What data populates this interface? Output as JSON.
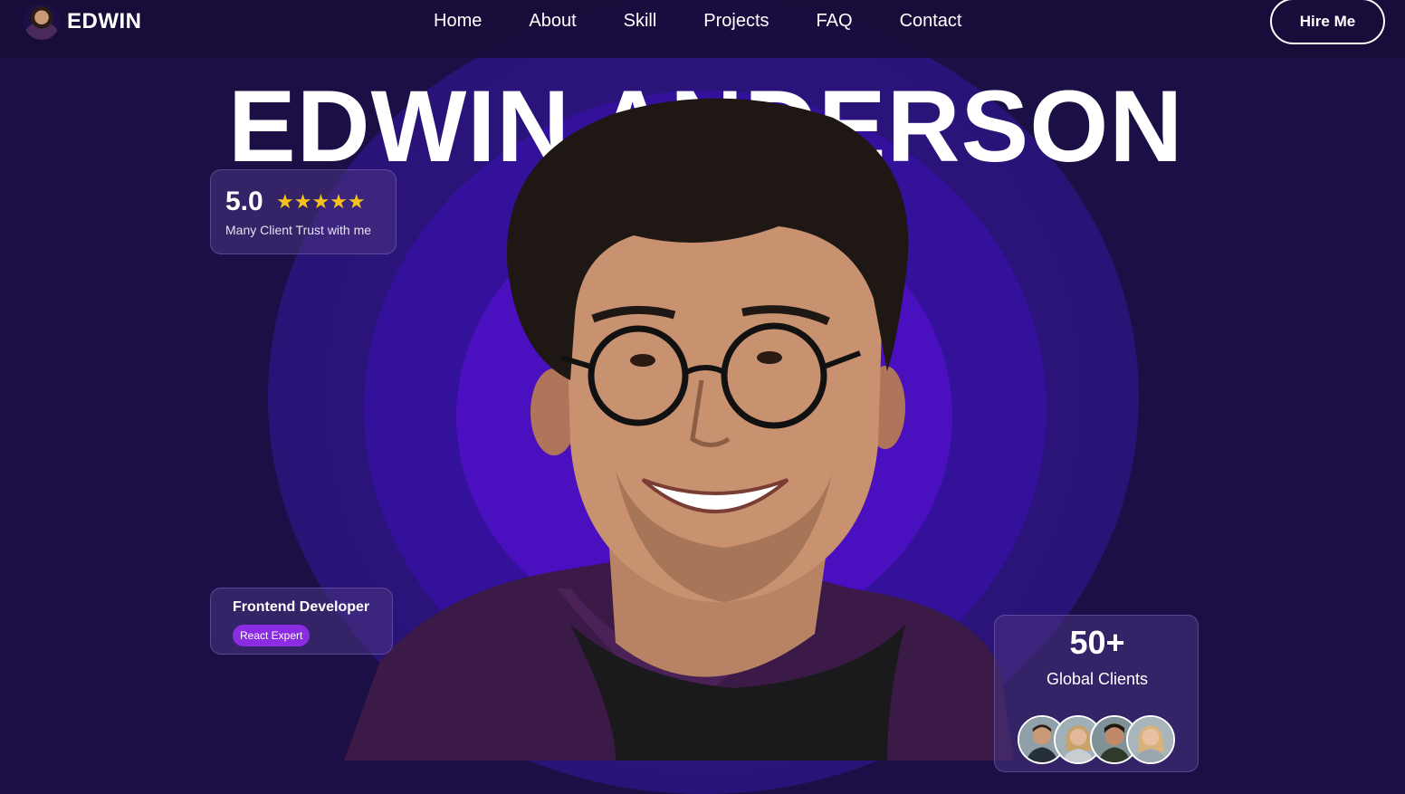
{
  "brand": {
    "name": "EDWIN"
  },
  "nav": {
    "items": [
      {
        "label": "Home"
      },
      {
        "label": "About"
      },
      {
        "label": "Skill"
      },
      {
        "label": "Projects"
      },
      {
        "label": "FAQ"
      },
      {
        "label": "Contact"
      }
    ],
    "cta": "Hire Me"
  },
  "hero": {
    "headline": "EDWIN ANDERSON",
    "rating": {
      "value": "5.0",
      "stars": "★★★★★",
      "caption": "Many Client Trust with me"
    },
    "role": {
      "title": "Frontend Developer",
      "badge": "React Expert"
    },
    "clients": {
      "value": "50+",
      "label": "Global Clients"
    }
  },
  "colors": {
    "background": "#1c0f45",
    "accent": "#4a0fbf",
    "badge": "#8b2be2",
    "star": "#f6c21a"
  },
  "icons": [
    "brand-avatar-icon",
    "star-icon"
  ]
}
